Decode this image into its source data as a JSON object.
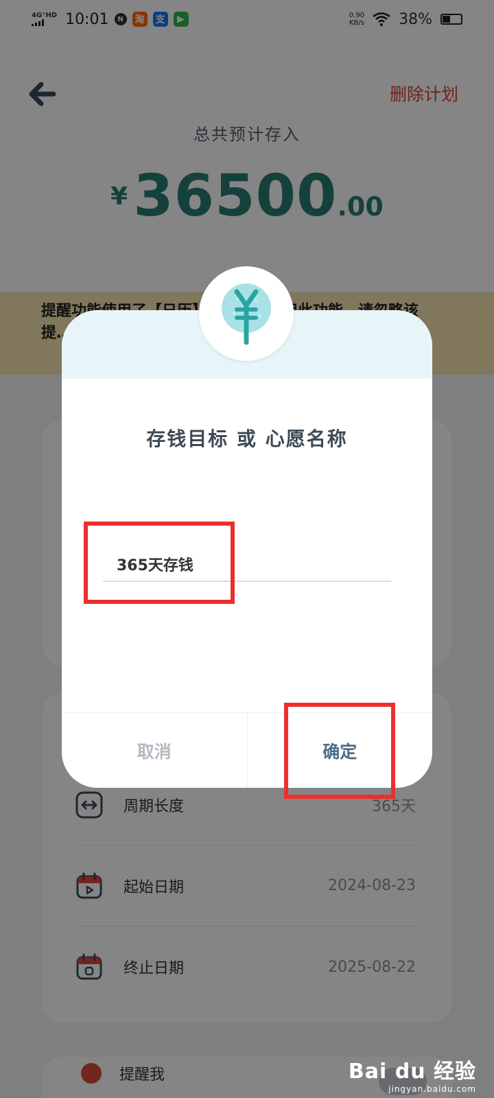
{
  "status_bar": {
    "network": "4G⁺HD",
    "time": "10:01",
    "speed_value": "0.90",
    "speed_unit": "KB/s",
    "battery": "38%",
    "apps": [
      {
        "name": "taobao",
        "glyph": "淘",
        "color": "#ff6a00"
      },
      {
        "name": "alipay",
        "glyph": "支",
        "color": "#1677ff"
      },
      {
        "name": "video",
        "glyph": "▶",
        "color": "#2db84d"
      }
    ]
  },
  "header": {
    "delete_label": "删除计划",
    "total_label": "总共预计存入",
    "currency": "¥",
    "amount_int": "36500",
    "amount_dec": ".00"
  },
  "notice": {
    "text": "提醒功能使用了【日历】……若不使用此功能，请忽略该提……点击此……"
  },
  "details": {
    "rows": [
      {
        "label": "周期长度",
        "value": "365天"
      },
      {
        "label": "起始日期",
        "value": "2024-08-23"
      },
      {
        "label": "终止日期",
        "value": "2025-08-22"
      }
    ],
    "remind_label": "提醒我"
  },
  "dialog": {
    "title": "存钱目标 或 心愿名称",
    "input_value": "365天存钱",
    "cancel_label": "取消",
    "confirm_label": "确定"
  },
  "colors": {
    "accent_green": "#2a7d73",
    "delete_red": "#d5413a",
    "highlight_red": "#ee2e2e",
    "confirm_blue": "#4f6c86"
  },
  "watermark": {
    "main": "Bai du 经验",
    "sub": "jingyan.baidu.com"
  }
}
